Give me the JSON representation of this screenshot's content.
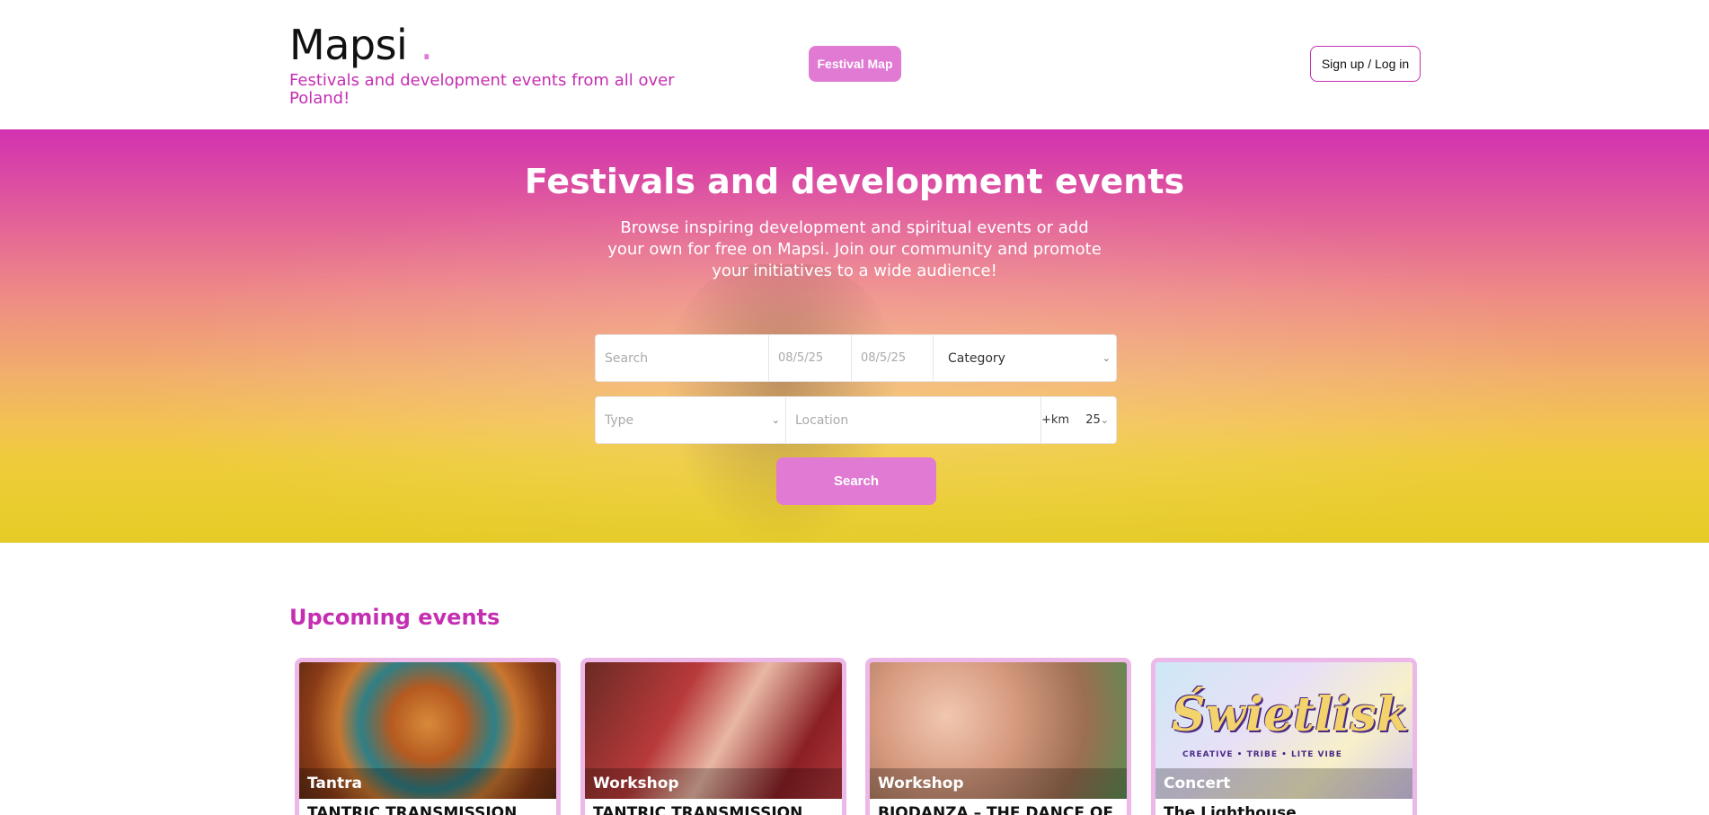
{
  "header": {
    "brand": "Mapsi",
    "brand_dot": ".",
    "tagline": "Festivals and development events from all over Poland!",
    "festival_map": "Festival Map",
    "signup": "Sign up / Log in"
  },
  "hero": {
    "title": "Festivals and development events",
    "description": "Browse inspiring development and spiritual events or add your own for free on Mapsi. Join our community and promote your initiatives to a wide audience!",
    "search_placeholder": "Search",
    "date_from": "08/5/25",
    "date_to": "08/5/25",
    "category": "Category",
    "type": "Type",
    "location_placeholder": "Location",
    "km_label": "+km",
    "km_value": "25",
    "search_button": "Search"
  },
  "upcoming": {
    "title": "Upcoming events",
    "cards": [
      {
        "tag": "Tantra",
        "title": "TANTRIC TRANSMISSION"
      },
      {
        "tag": "Workshop",
        "title": "TANTRIC TRANSMISSION"
      },
      {
        "tag": "Workshop",
        "title": "BIODANZA – THE DANCE OF"
      },
      {
        "tag": "Concert",
        "title": "The Lighthouse",
        "image_text": "Świetlisk",
        "image_subtext": "CREATIVE • TRIBE • LITE VIBE"
      }
    ]
  },
  "colors": {
    "accent": "#e07ad3",
    "brand_pink": "#c42fb2",
    "card_border": "#ecb8e7"
  }
}
